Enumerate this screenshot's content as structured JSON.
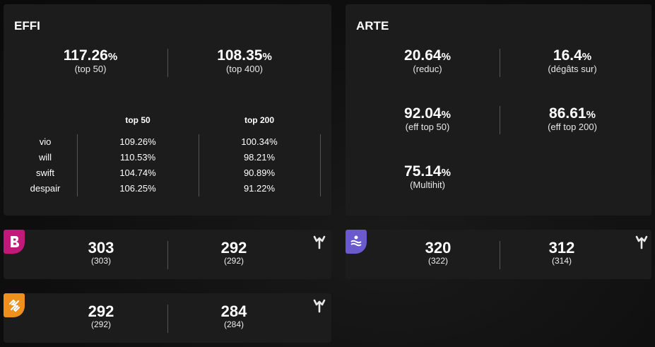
{
  "effi": {
    "title": "EFFI",
    "top_stats": [
      {
        "value": "117.26",
        "unit": "%",
        "label": "(top 50)"
      },
      {
        "value": "108.35",
        "unit": "%",
        "label": "(top 400)"
      }
    ],
    "table": {
      "headers": [
        "top 50",
        "top 200"
      ],
      "rows": [
        {
          "label": "vio",
          "top50": "109.26%",
          "top200": "100.34%"
        },
        {
          "label": "will",
          "top50": "110.53%",
          "top200": "98.21%"
        },
        {
          "label": "swift",
          "top50": "104.74%",
          "top200": "90.89%"
        },
        {
          "label": "despair",
          "top50": "106.25%",
          "top200": "91.22%"
        }
      ]
    }
  },
  "arte": {
    "title": "ARTE",
    "stats": [
      {
        "value": "20.64",
        "unit": "%",
        "label": "(reduc)"
      },
      {
        "value": "16.4",
        "unit": "%",
        "label": "(dégâts sur)"
      },
      {
        "value": "92.04",
        "unit": "%",
        "label": "(eff top 50)"
      },
      {
        "value": "86.61",
        "unit": "%",
        "label": "(eff top 200)"
      },
      {
        "value": "75.14",
        "unit": "%",
        "label": "(Multihit)"
      }
    ]
  },
  "cards": [
    {
      "icon": "pink-b-icon",
      "color": "#c2187a",
      "left": "303",
      "left_sub": "(303)",
      "right": "292",
      "right_sub": "(292)"
    },
    {
      "icon": "purple-wave-icon",
      "color": "#6a5acd",
      "left": "320",
      "left_sub": "(322)",
      "right": "312",
      "right_sub": "(314)"
    },
    {
      "icon": "orange-bolt-icon",
      "color": "#f0901c",
      "left": "292",
      "left_sub": "(292)",
      "right": "284",
      "right_sub": "(284)"
    }
  ]
}
